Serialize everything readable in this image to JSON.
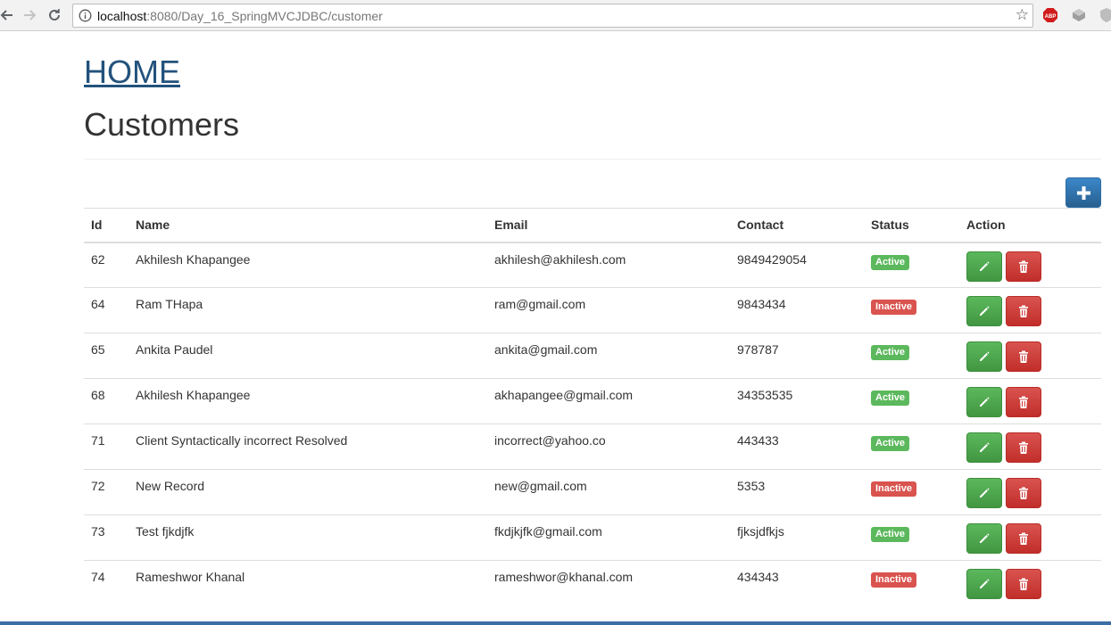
{
  "browser": {
    "url_host": "localhost",
    "url_path": ":8080/Day_16_SpringMVCJDBC/customer",
    "extensions": [
      "abp-icon",
      "extension-icon",
      "shield-icon"
    ]
  },
  "page": {
    "home_link": "HOME",
    "title": "Customers"
  },
  "table": {
    "headers": {
      "id": "Id",
      "name": "Name",
      "email": "Email",
      "contact": "Contact",
      "status": "Status",
      "action": "Action"
    },
    "rows": [
      {
        "id": "62",
        "name": "Akhilesh Khapangee",
        "email": "akhilesh@akhilesh.com",
        "contact": "9849429054",
        "status": "Active"
      },
      {
        "id": "64",
        "name": "Ram THapa",
        "email": "ram@gmail.com",
        "contact": "9843434",
        "status": "Inactive"
      },
      {
        "id": "65",
        "name": "Ankita Paudel",
        "email": "ankita@gmail.com",
        "contact": "978787",
        "status": "Active"
      },
      {
        "id": "68",
        "name": "Akhilesh Khapangee",
        "email": "akhapangee@gmail.com",
        "contact": "34353535",
        "status": "Active"
      },
      {
        "id": "71",
        "name": "Client Syntactically incorrect Resolved",
        "email": "incorrect@yahoo.co",
        "contact": "443433",
        "status": "Active"
      },
      {
        "id": "72",
        "name": "New Record",
        "email": "new@gmail.com",
        "contact": "5353",
        "status": "Inactive"
      },
      {
        "id": "73",
        "name": "Test fjkdjfk",
        "email": "fkdjkjfk@gmail.com",
        "contact": "fjksjdfkjs",
        "status": "Active"
      },
      {
        "id": "74",
        "name": "Rameshwor Khanal",
        "email": "rameshwor@khanal.com",
        "contact": "434343",
        "status": "Inactive"
      }
    ]
  },
  "colors": {
    "link": "#23527c",
    "primary": "#337ab7",
    "success": "#5cb85c",
    "danger": "#d9534f"
  }
}
